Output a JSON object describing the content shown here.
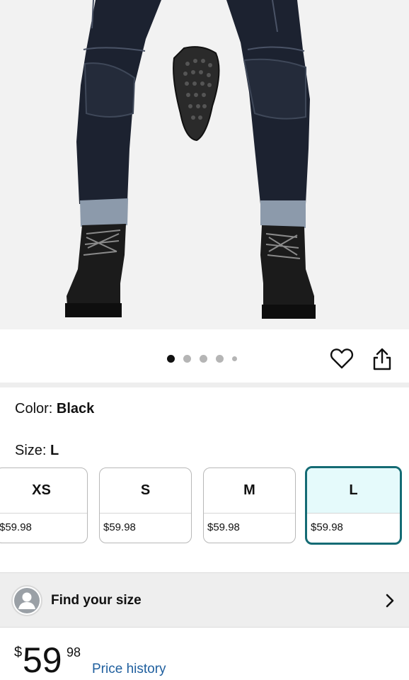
{
  "gallery": {
    "image_alt": "Product image: dark denim motorcycle jeans with knee armor and black boots",
    "dot_count": 5,
    "active_index": 0
  },
  "product": {
    "color_label": "Color:",
    "color_value": "Black",
    "size_label": "Size:",
    "size_value": "L"
  },
  "sizes": [
    {
      "label": "XS",
      "price": "$59.98",
      "selected": false
    },
    {
      "label": "S",
      "price": "$59.98",
      "selected": false
    },
    {
      "label": "M",
      "price": "$59.98",
      "selected": false
    },
    {
      "label": "L",
      "price": "$59.98",
      "selected": true
    }
  ],
  "find_size": {
    "label": "Find your size"
  },
  "price": {
    "currency": "$",
    "dollars": "59",
    "cents": "98",
    "history_link": "Price history"
  },
  "colors": {
    "selected_border": "#146b74",
    "selected_fill": "#e5fafb",
    "link": "#1f5f9e"
  },
  "icons": {
    "favorite": "heart-outline-icon",
    "share": "share-icon",
    "chevron": "chevron-right-icon",
    "avatar": "person-icon"
  }
}
